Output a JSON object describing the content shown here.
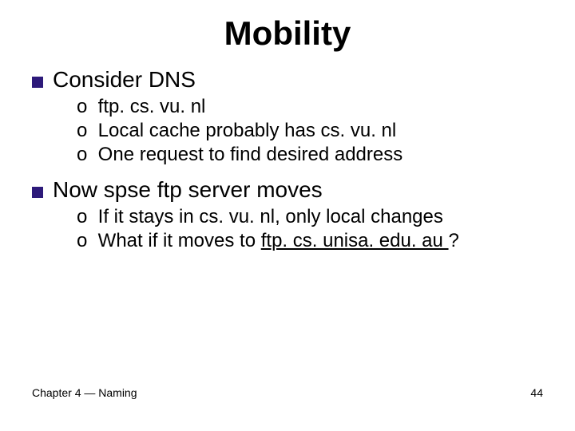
{
  "title": "Mobility",
  "point1": {
    "text": "Consider DNS",
    "subs": [
      "ftp. cs. vu. nl",
      "Local cache probably has cs. vu. nl",
      "One request to find desired address"
    ]
  },
  "point2": {
    "text": "Now spse ftp server moves",
    "subs": [
      "If it stays in cs. vu. nl, only local changes"
    ],
    "sub_last_prefix": "What if it moves to ",
    "sub_last_link": "ftp. cs. unisa. edu. au ",
    "sub_last_suffix": "?"
  },
  "bullet1": "❑",
  "bullet2": "o",
  "footer": {
    "left": "Chapter 4 — Naming",
    "right": "44"
  }
}
